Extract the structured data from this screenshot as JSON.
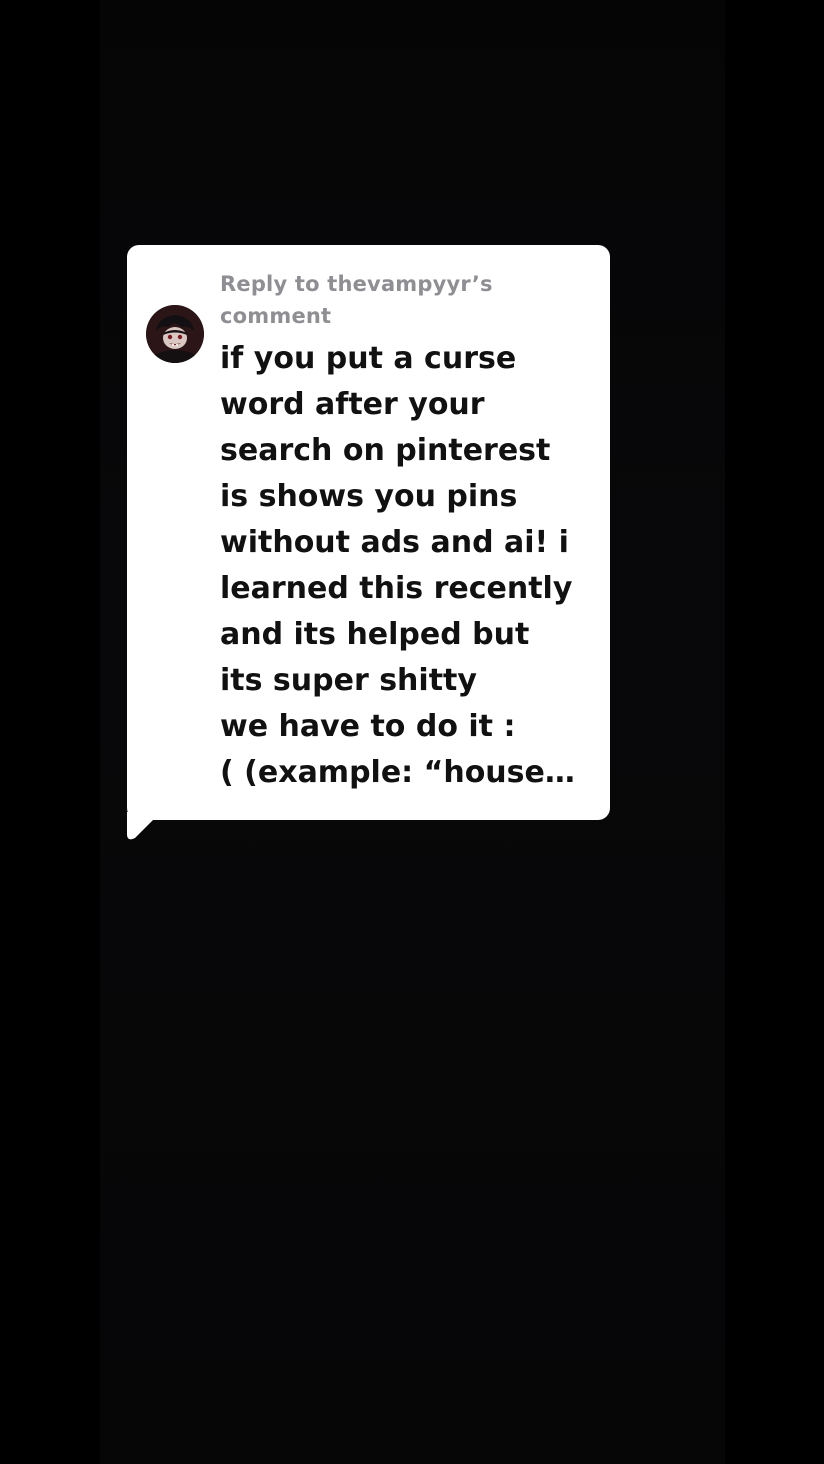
{
  "reply": {
    "header_line1": "Reply to thevampyyr’s",
    "header_line2": "comment",
    "avatar_icon": "vampire-avatar-icon"
  },
  "comment": {
    "lines": [
      "if you put a curse",
      "word after your",
      "search on pinterest",
      "is shows you pins",
      "without ads and ai! i",
      "learned this recently",
      "and its helped but",
      "its super shitty",
      "we have to do it :",
      "( (example: “house…"
    ]
  },
  "colors": {
    "background": "#000000",
    "bubble": "#ffffff",
    "header_text": "#8e8e93",
    "body_text": "#111111"
  }
}
